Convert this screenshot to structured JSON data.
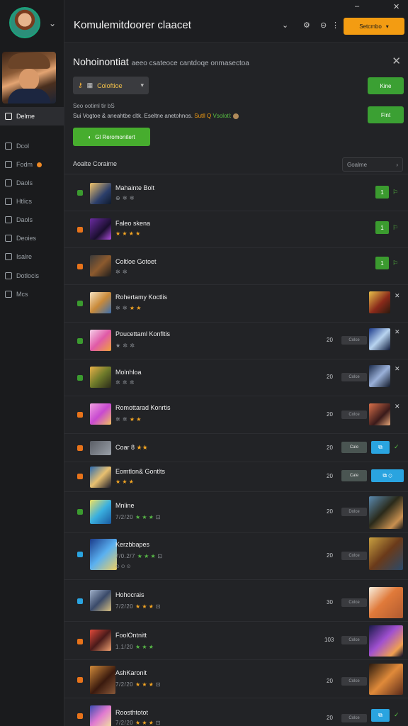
{
  "window": {
    "title": "Komulemitdoorer claacet",
    "minimize": "–",
    "close": "✕"
  },
  "toolbar": {
    "icon_a": "⌄",
    "icon_b": "⚙",
    "icon_c": "⊝",
    "icon_d": "⋮",
    "action_label": "Setcmbo",
    "action_chevron": "▾"
  },
  "sidebar": {
    "items": [
      {
        "label": "Delme",
        "icon": "square-icon",
        "active": true
      },
      {
        "label": "Dcol",
        "icon": "folder-icon"
      },
      {
        "label": "Fodm",
        "icon": "chat-icon",
        "badge": true
      },
      {
        "label": "Daols",
        "icon": "car-icon"
      },
      {
        "label": "Htlics",
        "icon": "grid-icon"
      },
      {
        "label": "Daols",
        "icon": "doc-icon"
      },
      {
        "label": "Deoies",
        "icon": "list-icon"
      },
      {
        "label": "Isalre",
        "icon": "bookmark-icon"
      },
      {
        "label": "Dotlocis",
        "icon": "disc-icon"
      },
      {
        "label": "Mcs",
        "icon": "camera-icon"
      }
    ]
  },
  "panel": {
    "title": "Nohoinontiat",
    "title_suffix": "aeeo csateoce cantdoqe onmasectoa",
    "close": "✕",
    "filter_label": "Coloftioe",
    "filter_chevron": "▾",
    "green_a": "Kine",
    "green_b": "Fint",
    "info_1": "Seo ootiml tir bS",
    "info_2_pre": "Sui Vogtoe & aneahtbe cltk. Eseltne anetohnos.",
    "info_2_hl": "Sutll Q",
    "info_2_ok": "Vsolotl:",
    "primary_label": "Gl Reromonitert",
    "list_title": "Aoalte Coraime",
    "sort_label": "Goalme",
    "sort_chevron": "›"
  },
  "rows": [
    {
      "name": "Mahainte Bolt",
      "sub": "⊕ ✲ ✲",
      "gsq": "1",
      "ricon": "⚐",
      "mark_color": "#3b9b2f"
    },
    {
      "name": "Faleo skena",
      "sub": "",
      "stars": "★ ★ ★ ★",
      "gsq": "1",
      "ricon": "⚐",
      "mark_color": "#e8731a"
    },
    {
      "name": "Coltloe Gotoet",
      "sub": "✲ ✲",
      "gsq": "1",
      "ricon": "⚐",
      "mark_color": "#e8731a"
    },
    {
      "name": "Rohertamy Koctlis",
      "sub": "✲ ✲",
      "stars": "★ ★",
      "xicon": "✕",
      "mark_color": "#3b9b2f"
    },
    {
      "name": "Poucettaml Konfltis",
      "sub": "★ ✲ ✲",
      "num": "20",
      "pill": "Colce",
      "xicon": "✕",
      "mark_color": "#3b9b2f"
    },
    {
      "name": "Molnhloa",
      "sub": "✲ ✲ ✲",
      "num": "20",
      "pill": "Colce",
      "xicon": "✕",
      "mark_color": "#3b9b2f"
    },
    {
      "name": "Romottarad Konrtis",
      "sub": "✲ ✲",
      "stars": "★ ★",
      "num": "20",
      "pill": "Colce",
      "xicon": "✕",
      "mark_color": "#e8731a"
    },
    {
      "name": "Coar 8",
      "stars": "★★",
      "num": "20",
      "pill": "Cale",
      "bsq": "⧉",
      "ricon": "✓",
      "mark_color": "#e8731a"
    },
    {
      "name": "Eomtlon& Gontlts",
      "sub": "",
      "stars": "★ ★ ★",
      "num": "20",
      "pill": "Cale",
      "bsq": "⧉ ⊙",
      "mark_color": "#e8731a"
    },
    {
      "name": "Mnline",
      "sub": "7/2/20",
      "gstars": "★ ★ ★",
      "num": "20",
      "pill": "Dolce",
      "mark_color": "#3b9b2f"
    },
    {
      "name": "Kerzbbapes",
      "sub": "7/0.2/7",
      "gstars": "★ ★ ★",
      "sub2": "⊙ ⊙ ⊙",
      "num": "20",
      "pill": "Colce",
      "mark_color": "#2aa4e0"
    },
    {
      "name": "Hohocrais",
      "sub": "7/2/20",
      "stars": "★ ★ ★",
      "num": "30",
      "pill": "Colce",
      "mark_color": "#2aa4e0"
    },
    {
      "name": "FoolOntnitt",
      "sub": "1.1/20",
      "gstars": "★ ★ ★",
      "num": "103",
      "pill": "Colce",
      "mark_color": "#e8731a"
    },
    {
      "name": "AshKaronit",
      "sub": "7/2/20",
      "stars": "★ ★ ★",
      "num": "20",
      "pill": "Colce",
      "mark_color": "#e8731a"
    },
    {
      "name": "Roosthtotot",
      "sub": "7/2/20",
      "stars": "★ ★ ★",
      "num": "20",
      "pill": "Colce",
      "bsq": "⧉",
      "ricon": "✓",
      "mark_color": "#e8731a"
    }
  ]
}
